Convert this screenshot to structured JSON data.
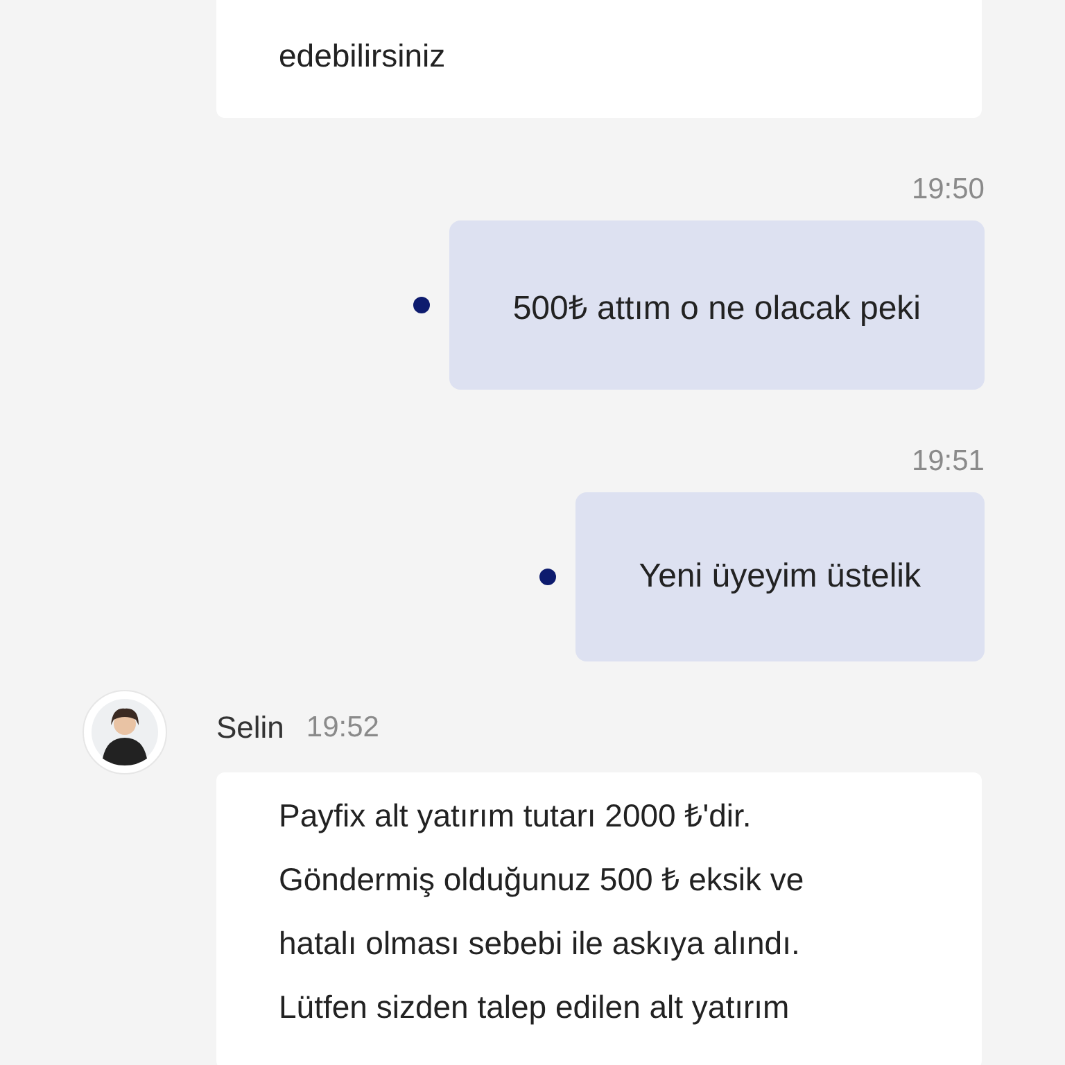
{
  "messages": [
    {
      "kind": "agent",
      "lines": [
        "edebilirsiniz"
      ]
    },
    {
      "kind": "user",
      "time": "19:50",
      "text": "500₺ attım o ne olacak peki",
      "delivered": true
    },
    {
      "kind": "user",
      "time": "19:51",
      "text": "Yeni üyeyim üstelik",
      "delivered": true
    },
    {
      "kind": "agent",
      "sender": "Selin",
      "time": "19:52",
      "lines": [
        "Payfix alt yatırım tutarı 2000 ₺'dir.",
        "Göndermiş olduğunuz 500 ₺ eksik ve",
        "hatalı olması sebebi ile askıya alındı.",
        "Lütfen sizden talep edilen alt yatırım"
      ]
    }
  ]
}
